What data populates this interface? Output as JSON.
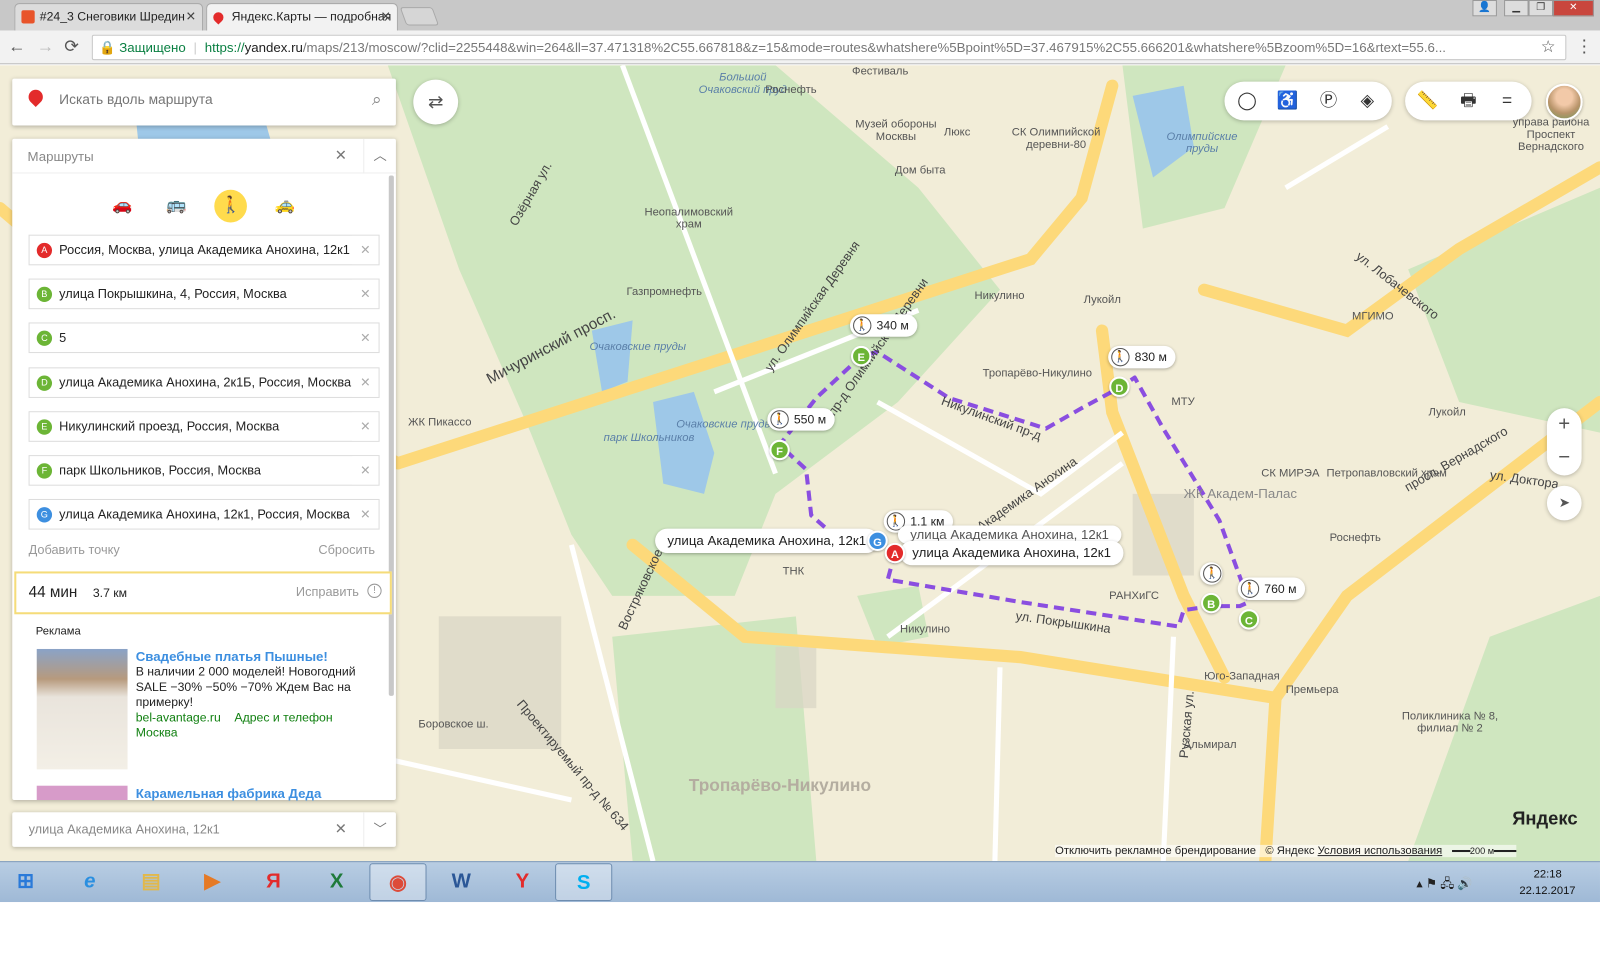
{
  "browser": {
    "tabs": [
      {
        "title": "#24_3 Снеговики Шредин",
        "close": "✕"
      },
      {
        "title": "Яндекс.Карты — подробная",
        "close": "✕"
      }
    ],
    "secure_label": "Защищено",
    "url_scheme": "https://",
    "url_host": "yandex.ru",
    "url_rest": "/maps/213/moscow/?clid=2255448&win=264&ll=37.471318%2C55.667818&z=15&mode=routes&whatshere%5Bpoint%5D=37.467915%2C55.666201&whatshere%5Bzoom%5D=16&rtext=55.6...",
    "back": "←",
    "forward": "→",
    "reload": "⟳",
    "star": "☆",
    "menu": "⋮"
  },
  "search": {
    "placeholder": "Искать вдоль маршрута"
  },
  "routes_panel": {
    "title": "Маршруты",
    "modes": [
      {
        "name": "car",
        "icon": "🚗"
      },
      {
        "name": "bus",
        "icon": "🚌"
      },
      {
        "name": "walk",
        "icon": "🚶"
      },
      {
        "name": "taxi",
        "icon": "🚕"
      }
    ],
    "points": [
      {
        "letter": "A",
        "value": "Россия, Москва, улица Академика Анохина, 12к1",
        "color": "#e32b2b"
      },
      {
        "letter": "B",
        "value": "улица Покрышкина, 4, Россия, Москва",
        "color": "#6cb536"
      },
      {
        "letter": "C",
        "value": "5",
        "color": "#6cb536"
      },
      {
        "letter": "D",
        "value": "улица Академика Анохина, 2к1Б, Россия, Москва",
        "color": "#6cb536"
      },
      {
        "letter": "E",
        "value": "Никулинский проезд, Россия, Москва",
        "color": "#6cb536"
      },
      {
        "letter": "F",
        "value": "парк Школьников, Россия, Москва",
        "color": "#6cb536"
      },
      {
        "letter": "G",
        "value": "улица Академика Анохина, 12к1, Россия, Москва",
        "color": "#3d8fe0"
      }
    ],
    "add_point": "Добавить точку",
    "reset": "Сбросить",
    "summary": {
      "time": "44 мин",
      "distance": "3.7 км",
      "fix": "Исправить"
    },
    "ad": {
      "label": "Реклама",
      "title": "Свадебные платья Пышные!",
      "text": "В наличии 2 000 моделей! Новогодний SALE −30% −50% −70% Ждем Вас на примерку!",
      "site": "bel-avantage.ru",
      "contact": "Адрес и телефон",
      "city": "Москва",
      "next_title": "Карамельная фабрика Деда"
    }
  },
  "bottom_card": {
    "value": "улица Академика Анохина, 12к1"
  },
  "map": {
    "labels": [
      "Большой Очаковский пруд",
      "Роснефть",
      "Фестиваль",
      "Музей обороны Москвы",
      "Люкс",
      "СК Олимпийской деревни-80",
      "Олимпийские пруды",
      "Дом быта",
      "Неопалимовский храм",
      "Газпромнефть",
      "Лукойл",
      "Никулино",
      "МГИМО",
      "Очаковские пруды",
      "ЖК Пикассо",
      "Тропарёво-Никулино",
      "МТУ",
      "парк Школьников",
      "Очаковские пруды",
      "Лукойл",
      "СК МИРЭА",
      "Петропавловский храм",
      "ЖК Академ-Палас",
      "Роснефть",
      "ТНК",
      "РАНХиГС",
      "Никулино",
      "Юго-Западная",
      "Премьера",
      "Альмирал",
      "Поликлиника № 8, филиал № 2",
      "Тропарёво-Никулино",
      "управа района Проспект Вернадского",
      "Мичуринский просп.",
      "ул. Олимпийская Деревня",
      "пр-д Олимпийской Деревни",
      "Никулинский пр-д",
      "ул. Академика Анохина",
      "ул. Покрышкина",
      "ул. Лобачевского",
      "просп. Вернадского",
      "Боровское ш.",
      "Проектируемый пр-д № 634",
      "Озёрная ул.",
      "Рузская ул.",
      "ул. Доктора",
      "Востряковское ш."
    ],
    "distances": [
      "340 м",
      "830 м",
      "550 м",
      "1,1 км",
      "760 м"
    ],
    "address_labels": [
      "улица Академика Анохина, 12к1",
      "улица Академика Анохина, 12к1",
      "улица Академика Анохина, 12к1"
    ],
    "route_color": "#8a4ee0",
    "zoom_in": "+",
    "zoom_out": "−",
    "logo": "Яндекс",
    "footer": {
      "disable_branding": "Отключить рекламное брендирование",
      "copyright": "© Яндекс",
      "terms": "Условия использования",
      "scale": "200 м"
    }
  },
  "taskbar": {
    "time": "22:18",
    "date": "22.12.2017"
  }
}
